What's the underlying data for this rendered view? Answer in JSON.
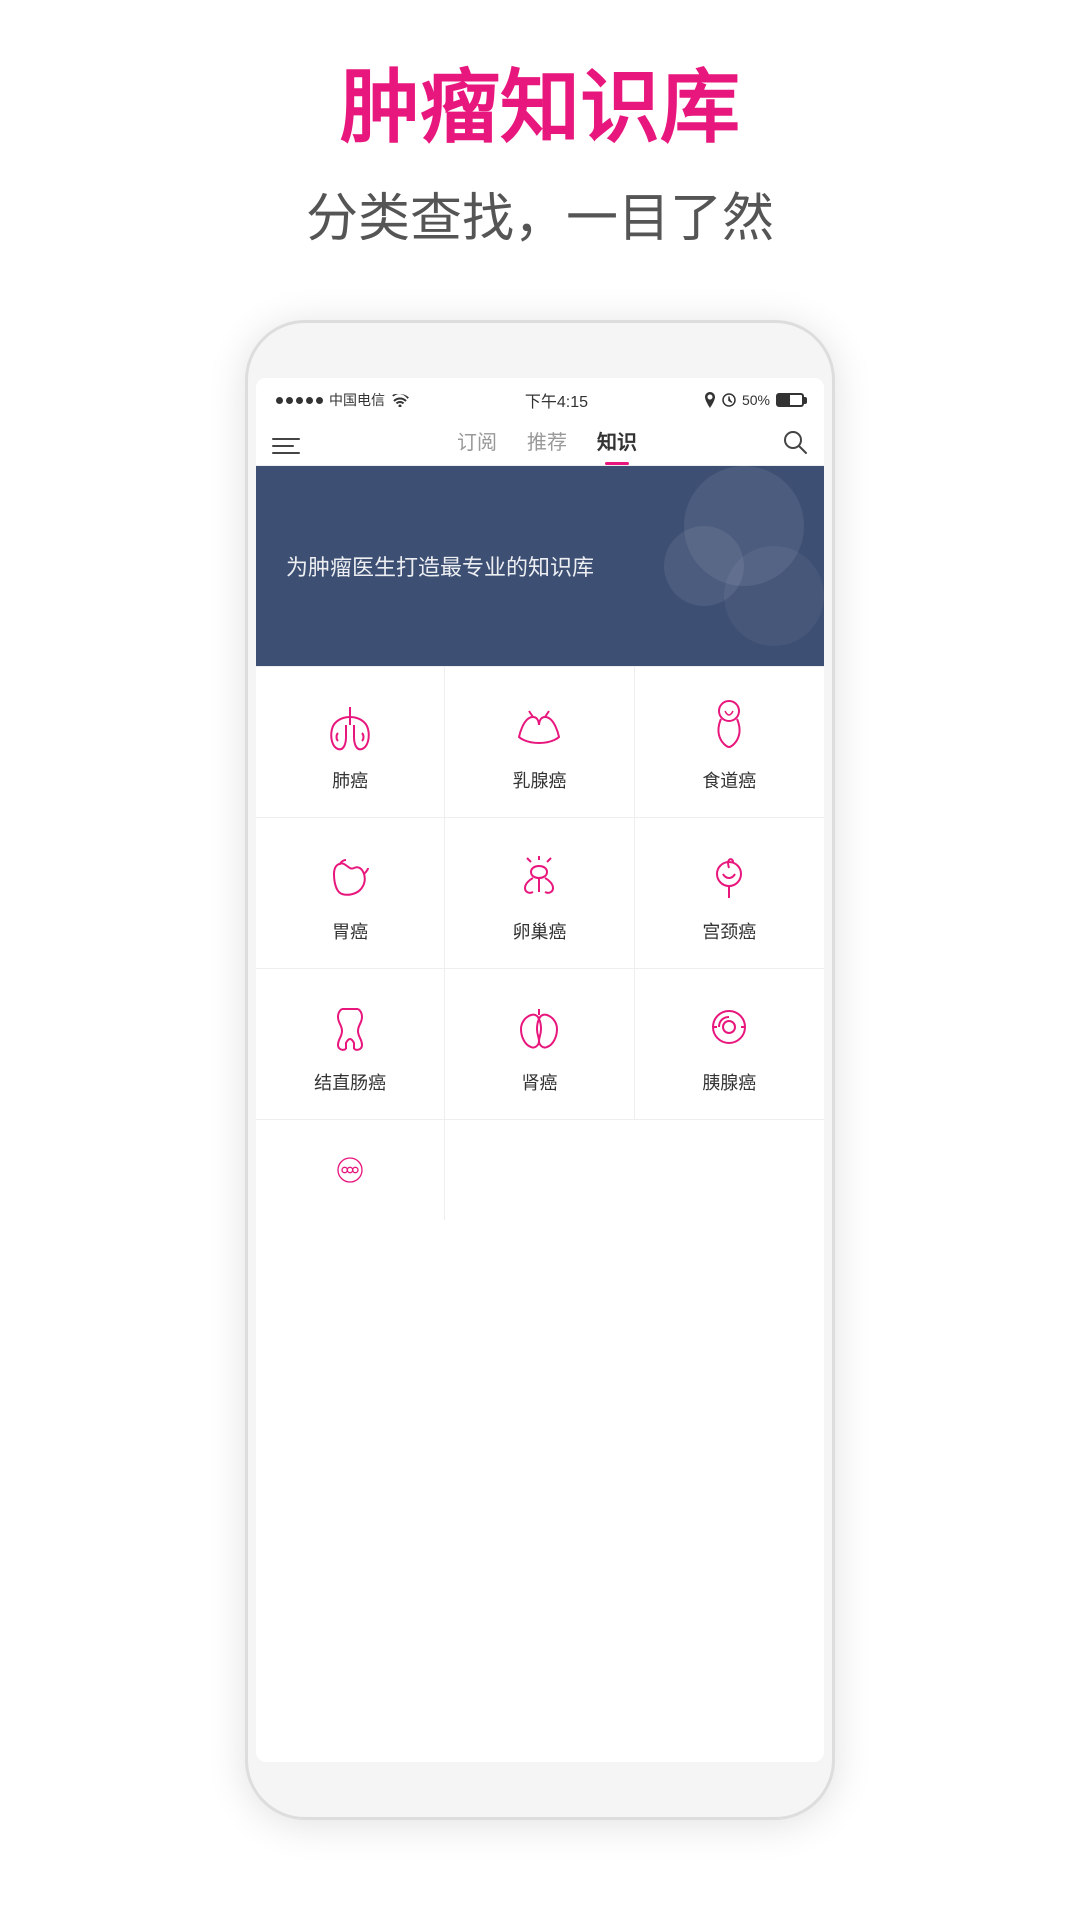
{
  "page": {
    "title": "肿瘤知识库",
    "subtitle": "分类查找，一目了然"
  },
  "statusBar": {
    "carrier": "中国电信",
    "time": "下午4:15",
    "battery": "50%"
  },
  "nav": {
    "tabs": [
      {
        "id": "subscribe",
        "label": "订阅",
        "active": false
      },
      {
        "id": "recommend",
        "label": "推荐",
        "active": false
      },
      {
        "id": "knowledge",
        "label": "知识",
        "active": true
      }
    ]
  },
  "banner": {
    "text": "为肿瘤医生打造最专业的知识库"
  },
  "cancerTypes": [
    {
      "id": "lung",
      "label": "肺癌",
      "icon": "lung"
    },
    {
      "id": "breast",
      "label": "乳腺癌",
      "icon": "breast"
    },
    {
      "id": "esophagus",
      "label": "食道癌",
      "icon": "esophagus"
    },
    {
      "id": "stomach",
      "label": "胃癌",
      "icon": "stomach"
    },
    {
      "id": "ovary",
      "label": "卵巢癌",
      "icon": "ovary"
    },
    {
      "id": "cervix",
      "label": "宫颈癌",
      "icon": "cervix"
    },
    {
      "id": "colon",
      "label": "结直肠癌",
      "icon": "colon"
    },
    {
      "id": "kidney",
      "label": "肾癌",
      "icon": "kidney"
    },
    {
      "id": "pancreas",
      "label": "胰腺癌",
      "icon": "pancreas"
    },
    {
      "id": "other",
      "label": "",
      "icon": "other"
    }
  ]
}
